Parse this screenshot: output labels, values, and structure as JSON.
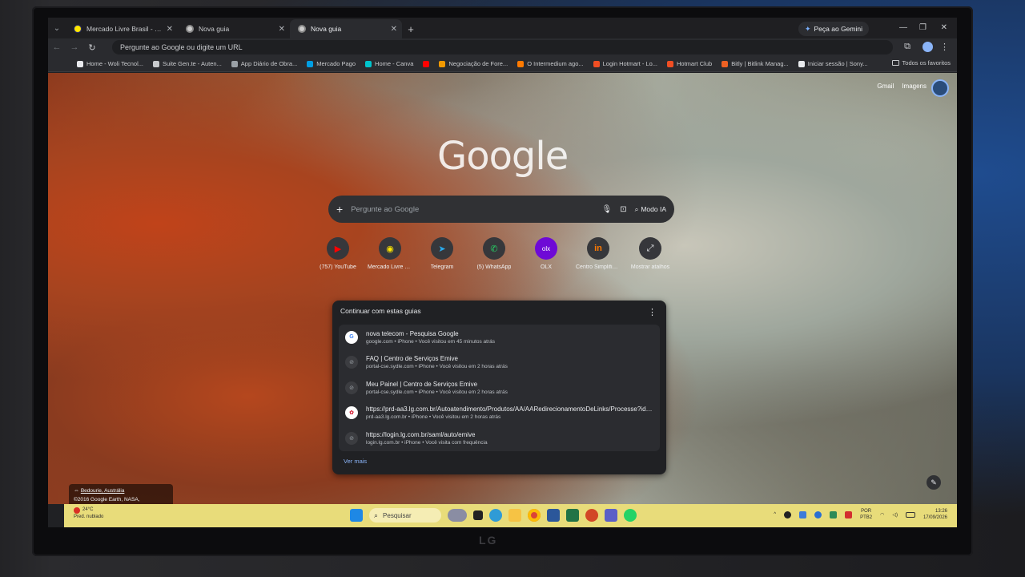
{
  "tabs": [
    {
      "title": "Mercado Livre Brasil - Frete Grátis",
      "favicon": "mercado-livre"
    },
    {
      "title": "Nova guia",
      "favicon": "chrome"
    },
    {
      "title": "Nova guia",
      "favicon": "chrome",
      "active": true
    }
  ],
  "new_tab_label": "+",
  "gemini_button": "Peça ao Gemini",
  "omnibox_placeholder": "Pergunte ao Google ou digite um URL",
  "bookmarks": [
    {
      "label": "Home - Woli Tecnol...",
      "color": "#e8eaed"
    },
    {
      "label": "Suite Gen.te - Auten...",
      "color": "#c8cacd"
    },
    {
      "label": "App Diário de Obra...",
      "color": "#9aa0a6"
    },
    {
      "label": "Mercado Pago",
      "color": "#009ee3"
    },
    {
      "label": "Home - Canva",
      "color": "#00c4cc"
    },
    {
      "label": "",
      "color": "#ff0000"
    },
    {
      "label": "Negociação de Fore...",
      "color": "#f29900"
    },
    {
      "label": "O Intermedium ago...",
      "color": "#ff7a00"
    },
    {
      "label": "Login Hotmart - Lo...",
      "color": "#f04e23"
    },
    {
      "label": "Hotmart Club",
      "color": "#f04e23"
    },
    {
      "label": "Bitly | Bitlink Manag...",
      "color": "#ee6123"
    },
    {
      "label": "Iniciar sessão | Sony...",
      "color": "#e8eaed"
    }
  ],
  "all_bookmarks": "Todos os favoritos",
  "ntp": {
    "links": [
      "Gmail",
      "Imagens"
    ],
    "logo": "Google",
    "search_placeholder": "Pergunte ao Google",
    "ai_mode": "Modo IA"
  },
  "shortcuts": [
    {
      "label": "(757) YouTube",
      "icon": "youtube-icon",
      "color": "#ff0000",
      "glyph": "▶"
    },
    {
      "label": "Mercado Livre Br...",
      "icon": "mercado-livre-icon",
      "color": "#ffe600",
      "glyph": "◉"
    },
    {
      "label": "Telegram",
      "icon": "telegram-icon",
      "color": "#2aabee",
      "glyph": "➤"
    },
    {
      "label": "(5) WhatsApp",
      "icon": "whatsapp-icon",
      "color": "#25d366",
      "glyph": "✆"
    },
    {
      "label": "OLX",
      "icon": "olx-icon",
      "color": "#6e0ad6",
      "glyph": "olx"
    },
    {
      "label": "Centro Simplifica...",
      "icon": "intermedium-icon",
      "color": "#ff7a00",
      "glyph": "in"
    },
    {
      "label": "Mostrar atalhos",
      "icon": "expand-icon",
      "color": "#e8eaed",
      "glyph": "⤢"
    }
  ],
  "continue": {
    "title": "Continuar com estas guias",
    "items": [
      {
        "title": "nova telecom - Pesquisa Google",
        "sub": "google.com • iPhone • Você visitou em 45 minutos atrás",
        "icon": "g"
      },
      {
        "title": "FAQ | Centro de Serviços Emive",
        "sub": "portal-cse.sydle.com • iPhone • Você visitou em 2 horas atrás",
        "icon": "generic"
      },
      {
        "title": "Meu Painel | Centro de Serviços Emive",
        "sub": "portal-cse.sydle.com • iPhone • Você visitou em 2 horas atrás",
        "icon": "generic"
      },
      {
        "title": "https://prd-aa3.lg.com.br/Autoatendimento/Produtos/AA/AARedirecionamentoDeLinks/Processe?id=FUN.A...",
        "sub": "prd-aa3.lg.com.br • iPhone • Você visitou em 2 horas atrás",
        "icon": "lg"
      },
      {
        "title": "https://login.lg.com.br/saml/auto/emive",
        "sub": "login.lg.com.br • iPhone • Você visita com frequência",
        "icon": "generic"
      }
    ],
    "see_more": "Ver mais"
  },
  "attribution": {
    "place": "Bedourie, Austrália",
    "credit": "©2016 Google Earth, NASA, TerraMetrics"
  },
  "taskbar": {
    "weather_temp": "24°C",
    "weather_desc": "Pred. nublado",
    "search": "Pesquisar",
    "lang_top": "POR",
    "lang_bottom": "PTB2",
    "time": "13:26",
    "date": "17/09/2026"
  },
  "monitor_brand": "LG"
}
